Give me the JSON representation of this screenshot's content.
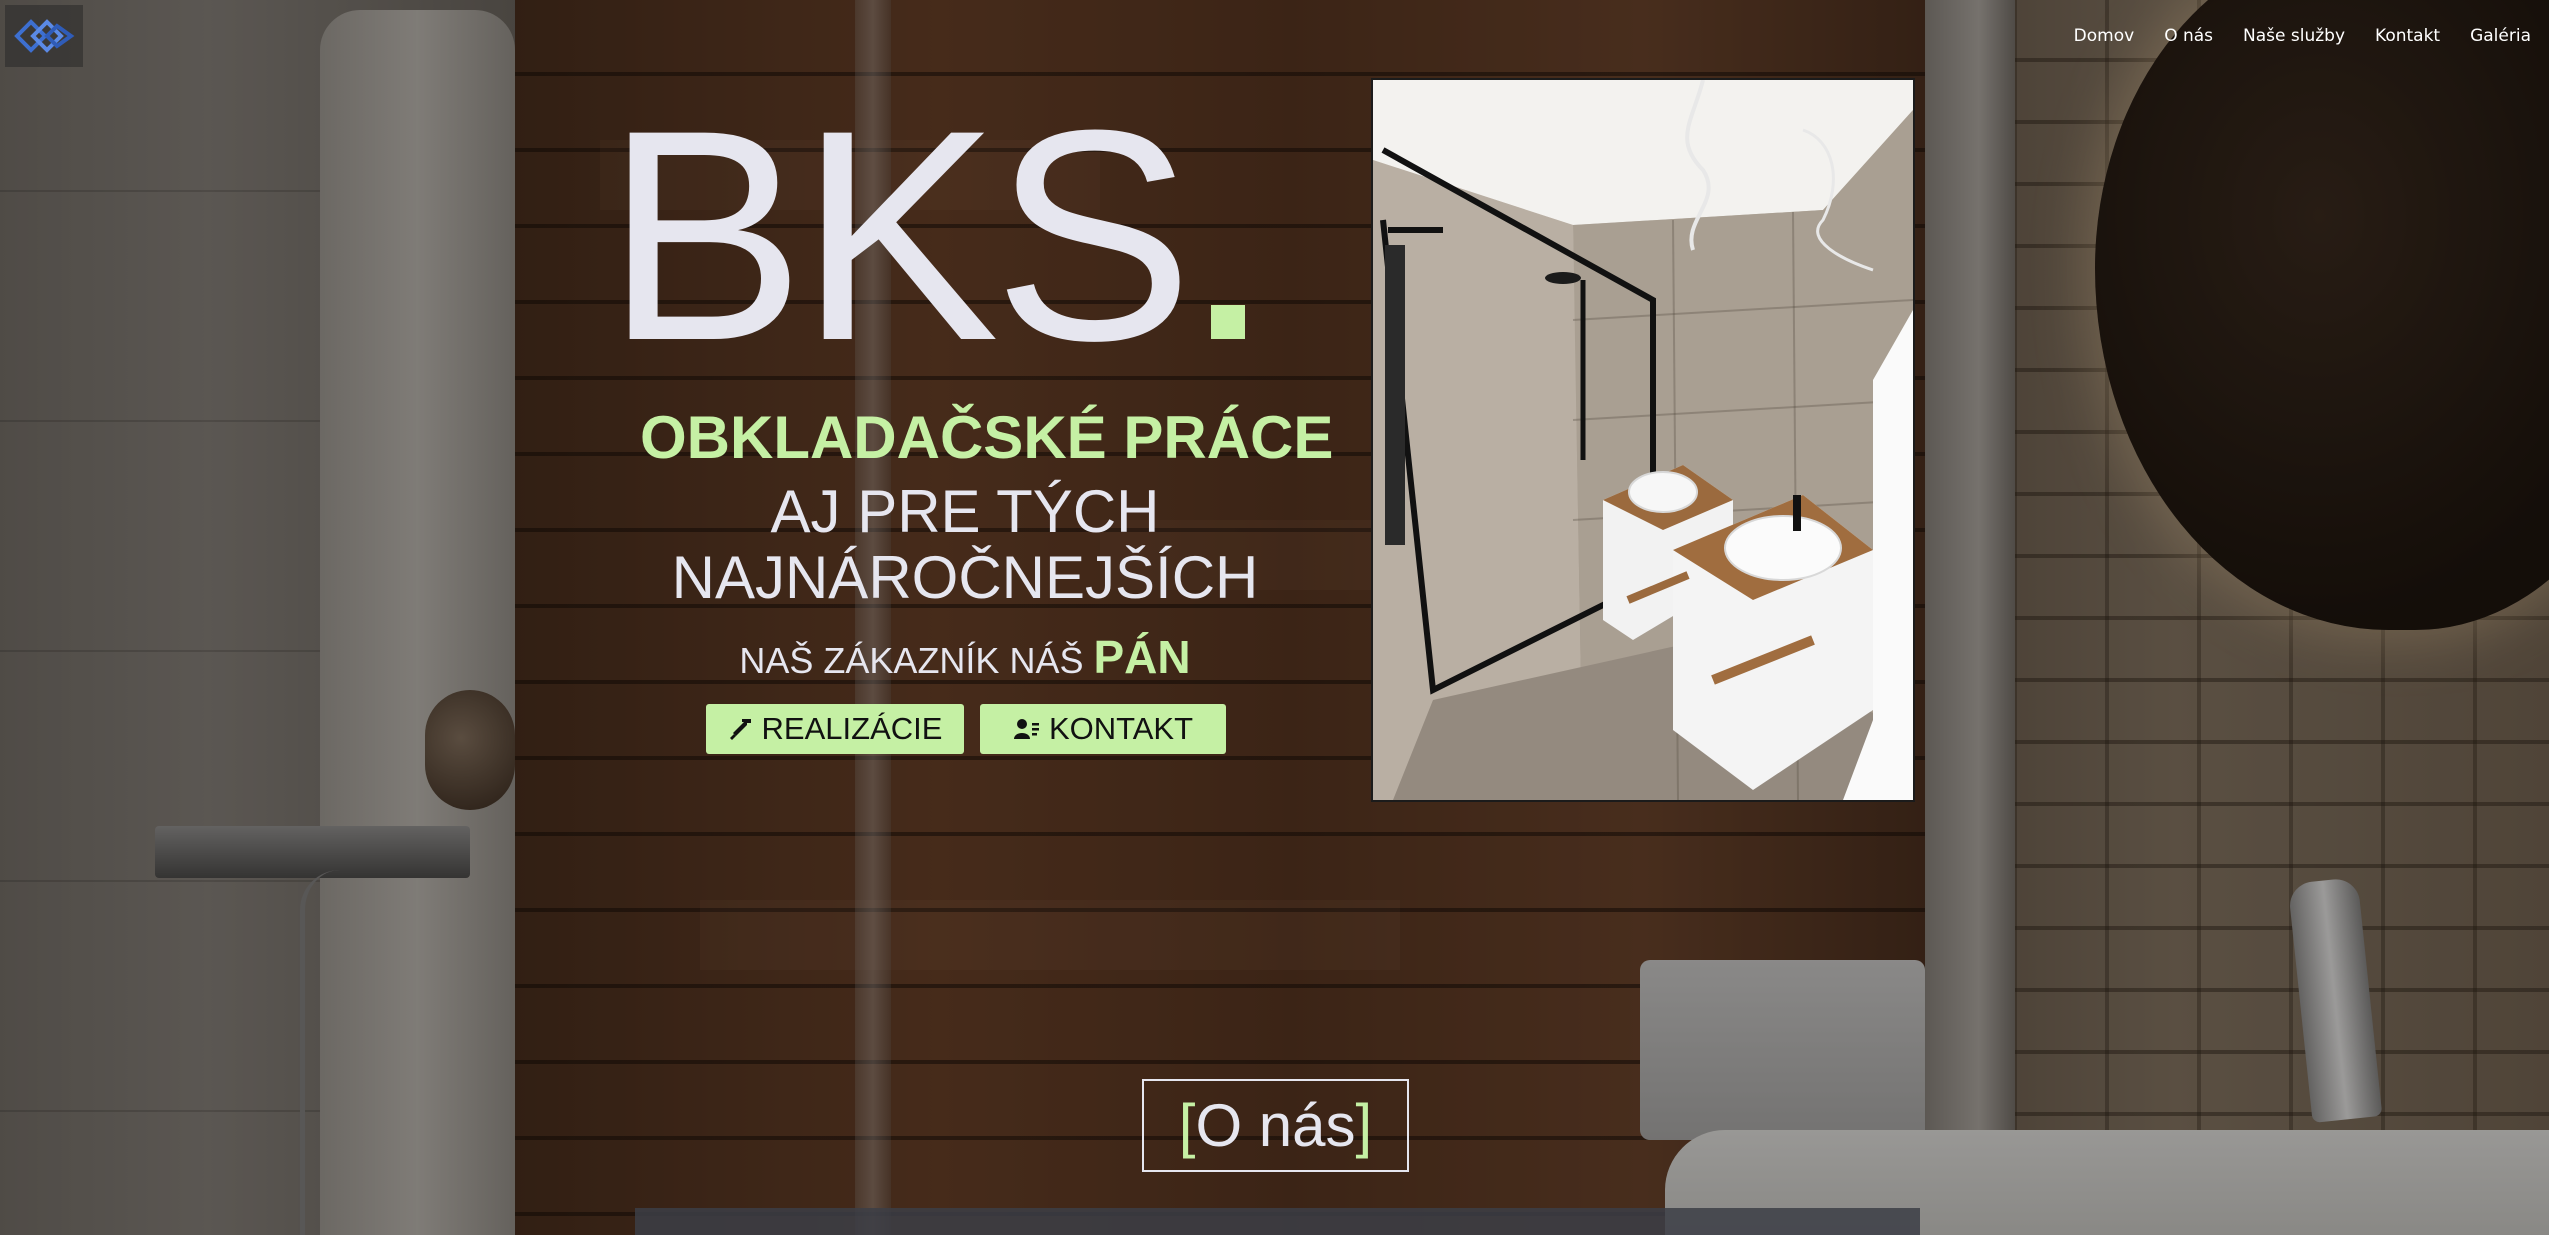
{
  "nav": {
    "items": [
      "Domov",
      "O nás",
      "Naše služby",
      "Kontakt",
      "Galéria"
    ]
  },
  "hero": {
    "brand": "BKS",
    "tagline_accent": "OBKLADAČSKÉ PRÁCE",
    "tagline_line1": "AJ PRE TÝCH",
    "tagline_line2": "NAJNÁROČNEJŠÍCH",
    "motto_prefix": "NAŠ ZÁKAZNÍK NÁŠ",
    "motto_accent": "PÁN",
    "buttons": {
      "realizacie": "REALIZÁCIE",
      "kontakt": "KONTAKT"
    }
  },
  "about_button": {
    "open": "[",
    "label": "O nás",
    "close": "]"
  },
  "colors": {
    "accent": "#c5f0a4",
    "text_light": "#e6e6ef"
  },
  "icons": {
    "logo": "bks-diamond-logo",
    "realizacie": "hammer-icon",
    "kontakt": "contact-card-icon"
  }
}
